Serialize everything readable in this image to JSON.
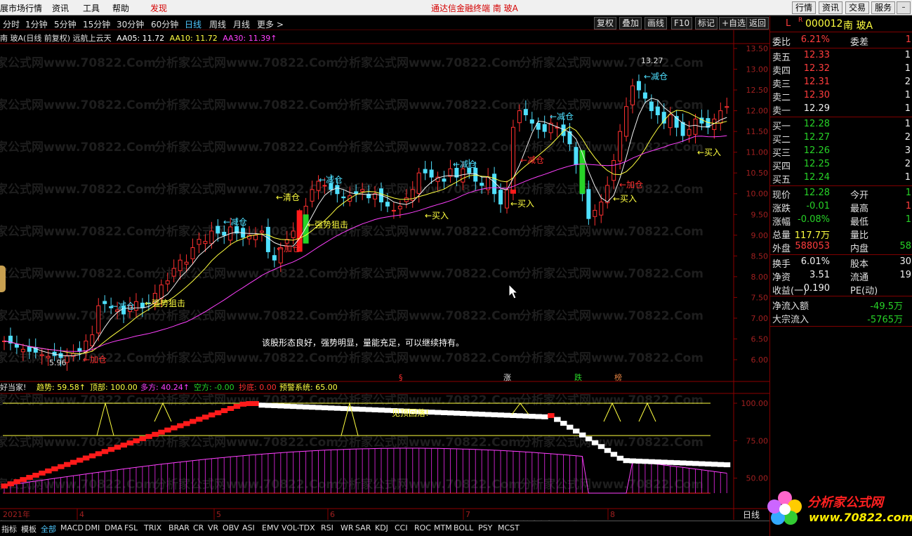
{
  "menubar": {
    "items": [
      "展市场行情",
      "资讯",
      "工具",
      "帮助"
    ],
    "hot_item": "发现",
    "title": "通达信金融终端   南 玻A",
    "right_buttons": [
      "行情",
      "资讯",
      "交易",
      "服务"
    ],
    "window_buttons": [
      "–",
      "□"
    ]
  },
  "periodbar": {
    "periods": [
      "分时",
      "1分钟",
      "5分钟",
      "15分钟",
      "30分钟",
      "60分钟",
      "日线",
      "周线",
      "月线",
      "更多 >"
    ],
    "active": "日线",
    "tools": [
      "复权",
      "叠加",
      "画线",
      "F10",
      "标记",
      "+自选",
      "返回"
    ]
  },
  "info": {
    "stock_title": "南 玻A(日线 前复权) 远航上云天",
    "ma5": "AA05: 11.72",
    "ma10": "AA10: 11.72",
    "ma30": "AA30: 11.39↑"
  },
  "main_chart": {
    "price_axis": [
      "13.50",
      "13.00",
      "12.50",
      "12.00",
      "11.50",
      "11.00",
      "10.50",
      "10.00",
      "9.50",
      "9.00",
      "8.50",
      "8.00",
      "7.50",
      "7.00",
      "6.50",
      "6.00"
    ],
    "high_label": "13.27",
    "low_label": "5.96",
    "comment": "该股形态良好，强势明显，量能充足，可以继续持有。",
    "annotations": [
      {
        "text": "←加仓",
        "color": "#ff3030"
      },
      {
        "text": "←减仓",
        "color": "#4fe0ff"
      },
      {
        "text": "←强势狙击",
        "color": "#ffff40"
      },
      {
        "text": "←减仓",
        "color": "#4fe0ff"
      },
      {
        "text": "←加仓",
        "color": "#ff3030"
      },
      {
        "text": "←清仓",
        "color": "#ffff40"
      },
      {
        "text": "←强势狙击",
        "color": "#ffff40"
      },
      {
        "text": "←减仓",
        "color": "#4fe0ff"
      },
      {
        "text": "←买入",
        "color": "#ffff40"
      },
      {
        "text": "←减仓",
        "color": "#4fe0ff"
      },
      {
        "text": "←买入",
        "color": "#ffff40"
      },
      {
        "text": "←减仓",
        "color": "#ff3030"
      },
      {
        "text": "←减仓",
        "color": "#4fe0ff"
      },
      {
        "text": "←买入",
        "color": "#ffff40"
      },
      {
        "text": "←加仓",
        "color": "#ff3030"
      },
      {
        "text": "←减仓",
        "color": "#4fe0ff"
      },
      {
        "text": "←买入",
        "color": "#ffff40"
      }
    ],
    "event_markers": [
      {
        "text": "§",
        "color": "#ff3030"
      },
      {
        "text": "涨",
        "color": "#e0e0e0"
      },
      {
        "text": "跌",
        "color": "#27d327"
      },
      {
        "text": "榜",
        "color": "#e08040"
      }
    ],
    "watermark": "分析家公式网www.70822.Com"
  },
  "indicator": {
    "name": "好当家!",
    "trend": "趋势: 59.58↑",
    "top": "顶部: 100.00",
    "long": "多方: 40.24↑",
    "short": "空方: -0.00",
    "bottom": "抄底: 0.00",
    "warning": "预警系统: 65.00",
    "axis": [
      "100.00",
      "75.00",
      "50.00"
    ],
    "label": "见顶回落!"
  },
  "date_axis": {
    "year": "2021年",
    "months": [
      "4",
      "5",
      "6",
      "7",
      "8"
    ],
    "period_label": "日线"
  },
  "quote": {
    "code": "000012",
    "name": "南 玻A",
    "flag_l": "L",
    "flag_r": "R",
    "weibi_label": "委比",
    "weibi": "6.21%",
    "weicha_label": "委差",
    "weicha": "1",
    "sells": [
      {
        "label": "卖五",
        "price": "12.33",
        "vol": "1"
      },
      {
        "label": "卖四",
        "price": "12.32",
        "vol": "1"
      },
      {
        "label": "卖三",
        "price": "12.31",
        "vol": "2"
      },
      {
        "label": "卖二",
        "price": "12.30",
        "vol": "1"
      },
      {
        "label": "卖一",
        "price": "12.29",
        "vol": "1"
      }
    ],
    "buys": [
      {
        "label": "买一",
        "price": "12.28",
        "vol": "1"
      },
      {
        "label": "买二",
        "price": "12.27",
        "vol": "2"
      },
      {
        "label": "买三",
        "price": "12.26",
        "vol": "3"
      },
      {
        "label": "买四",
        "price": "12.25",
        "vol": "2"
      },
      {
        "label": "买五",
        "price": "12.24",
        "vol": "1"
      }
    ],
    "stats": [
      {
        "l": "现价",
        "v": "12.28",
        "vc": "green",
        "l2": "今开",
        "v2": "1",
        "v2c": "green"
      },
      {
        "l": "涨跌",
        "v": "-0.01",
        "vc": "green",
        "l2": "最高",
        "v2": "1",
        "v2c": "red"
      },
      {
        "l": "涨幅",
        "v": "-0.08%",
        "vc": "green",
        "l2": "最低",
        "v2": "1",
        "v2c": "green"
      },
      {
        "l": "总量",
        "v": "117.7万",
        "vc": "yellow",
        "l2": "量比",
        "v2": "",
        "v2c": "white"
      },
      {
        "l": "外盘",
        "v": "588053",
        "vc": "red",
        "l2": "内盘",
        "v2": "58",
        "v2c": "green"
      }
    ],
    "stats2": [
      {
        "l": "换手",
        "v": "6.01%",
        "vc": "white",
        "l2": "股本",
        "v2": "30",
        "v2c": "white"
      },
      {
        "l": "净资",
        "v": "3.51",
        "vc": "white",
        "l2": "流通",
        "v2": "19",
        "v2c": "white"
      },
      {
        "l": "收益(一)",
        "v": "0.190",
        "vc": "white",
        "l2": "PE(动)",
        "v2": "",
        "v2c": "white"
      }
    ],
    "flows": [
      {
        "l": "净流入额",
        "v": "-49.5万"
      },
      {
        "l": "大宗流入",
        "v": "-5765万"
      }
    ]
  },
  "bottom_tabs": [
    "指标",
    "模板",
    "全部",
    "MACD",
    "DMI",
    "DMA",
    "FSL",
    "TRIX",
    "BRAR",
    "CR",
    "VR",
    "OBV",
    "ASI",
    "EMV",
    "VOL-TDX",
    "RSI",
    "WR",
    "SAR",
    "KDJ",
    "CCI",
    "ROC",
    "MTM",
    "BOLL",
    "PSY",
    "MCST"
  ],
  "bottom_active": "全部",
  "logo": {
    "line1": "分析家公式网",
    "line2": "www.70822.com"
  }
}
